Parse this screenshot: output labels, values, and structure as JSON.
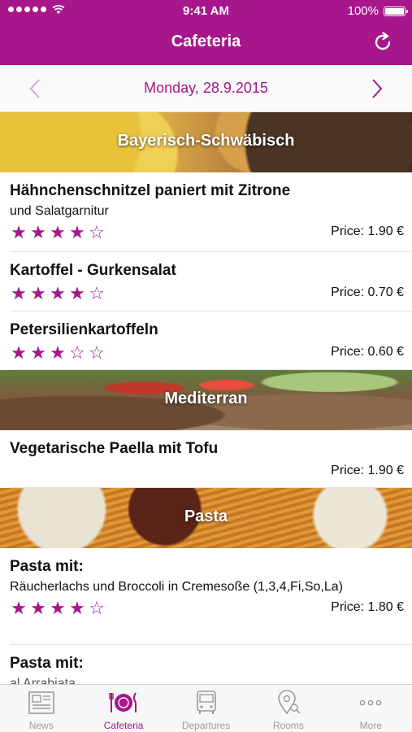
{
  "status_bar": {
    "time": "9:41 AM",
    "battery": "100%"
  },
  "header": {
    "title": "Cafeteria"
  },
  "date_bar": {
    "date": "Monday, 28.9.2015"
  },
  "sections": [
    {
      "title": "Bayerisch-Schwäbisch",
      "items": [
        {
          "name": "Hähnchenschnitzel paniert mit Zitrone",
          "description": "und Salatgarnitur",
          "rating": 4,
          "price": "Price: 1.90 €"
        },
        {
          "name": "Kartoffel - Gurkensalat",
          "rating": 4,
          "price": "Price: 0.70 €"
        },
        {
          "name": "Petersilienkartoffeln",
          "rating": 3,
          "price": "Price: 0.60 €"
        }
      ]
    },
    {
      "title": "Mediterran",
      "items": [
        {
          "name": "Vegetarische Paella mit Tofu",
          "price": "Price: 1.90 €"
        }
      ]
    },
    {
      "title": "Pasta",
      "items": [
        {
          "name": "Pasta mit:",
          "description": "Räucherlachs und Broccoli in Cremesoße (1,3,4,Fi,So,La)",
          "rating": 4,
          "price": "Price: 1.80 €"
        },
        {
          "name": "Pasta mit:",
          "description": "al Arrabiata"
        }
      ]
    }
  ],
  "tabs": [
    {
      "label": "News",
      "icon": "newspaper-icon"
    },
    {
      "label": "Cafeteria",
      "icon": "plate-cutlery-icon",
      "active": true
    },
    {
      "label": "Departures",
      "icon": "bus-icon"
    },
    {
      "label": "Rooms",
      "icon": "map-pin-search-icon"
    },
    {
      "label": "More",
      "icon": "more-dots-icon"
    }
  ],
  "colors": {
    "accent": "#a7168a",
    "tab_inactive": "#9a9a9a"
  }
}
